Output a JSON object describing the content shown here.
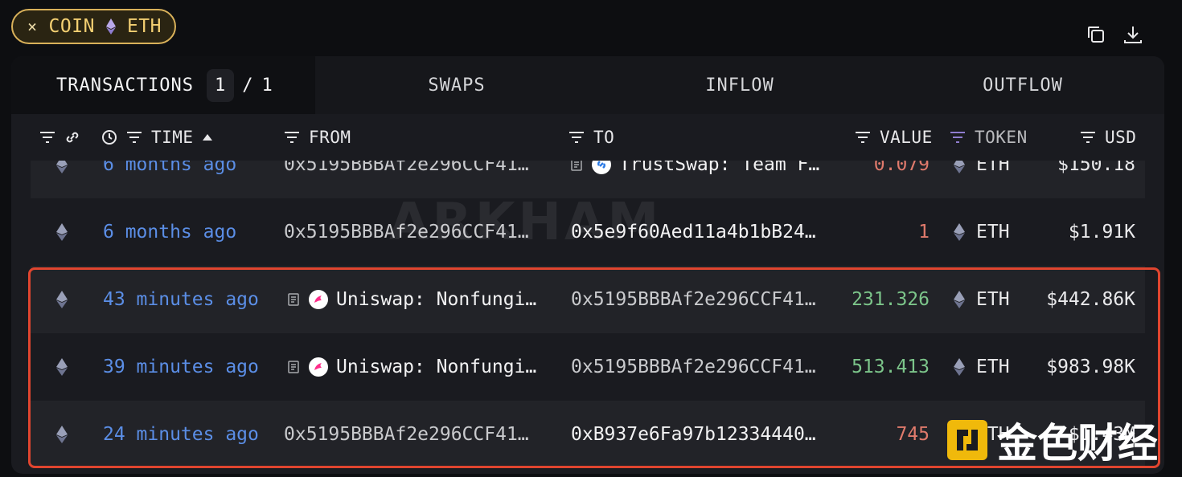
{
  "filter_chip": {
    "close": "×",
    "label": "COIN",
    "token": "ETH"
  },
  "tabs": [
    {
      "label": "TRANSACTIONS",
      "page_current": "1",
      "page_sep": "/",
      "page_total": "1"
    },
    {
      "label": "SWAPS"
    },
    {
      "label": "INFLOW"
    },
    {
      "label": "OUTFLOW"
    }
  ],
  "headers": {
    "time": "TIME",
    "from": "FROM",
    "to": "TO",
    "value": "VALUE",
    "token": "TOKEN",
    "usd": "USD"
  },
  "rows": [
    {
      "time": "6 months ago",
      "from": "0x5195BBBAf2e296CCF41…",
      "to": "TrustSwap: Team F…",
      "value": "0.079",
      "token": "ETH",
      "usd": "$150.18"
    },
    {
      "time": "6 months ago",
      "from": "0x5195BBBAf2e296CCF41…",
      "to": "0x5e9f60Aed11a4b1bB24…",
      "value": "1",
      "token": "ETH",
      "usd": "$1.91K"
    },
    {
      "time": "43 minutes ago",
      "from": "Uniswap: Nonfungi…",
      "to": "0x5195BBBAf2e296CCF41…",
      "value": "231.326",
      "token": "ETH",
      "usd": "$442.86K"
    },
    {
      "time": "39 minutes ago",
      "from": "Uniswap: Nonfungi…",
      "to": "0x5195BBBAf2e296CCF41…",
      "value": "513.413",
      "token": "ETH",
      "usd": "$983.98K"
    },
    {
      "time": "24 minutes ago",
      "from": "0x5195BBBAf2e296CCF41…",
      "to": "0xB937e6Fa97b12334440…",
      "value": "745",
      "token": "ETH",
      "usd": "$1.43M"
    }
  ],
  "watermark": "ARKHAM",
  "corner_logo_text": "金色财经",
  "colors": {
    "accent_time": "#5b8ee6",
    "value_out": "#e07a6c",
    "value_in": "#7cc58a",
    "chip_border": "#d9b15a",
    "highlight": "#e0452f"
  }
}
